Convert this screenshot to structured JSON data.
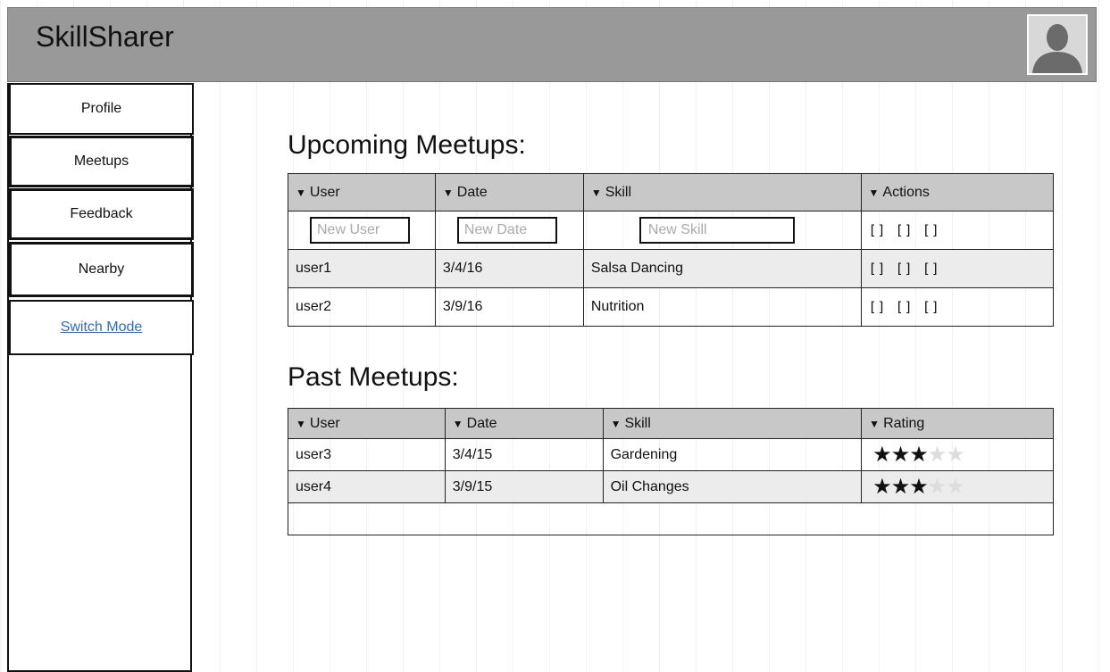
{
  "app": {
    "title": "SkillSharer"
  },
  "sidebar": {
    "items": [
      {
        "label": "Profile"
      },
      {
        "label": "Meetups"
      },
      {
        "label": "Feedback"
      },
      {
        "label": "Nearby"
      },
      {
        "label": "Switch Mode"
      }
    ]
  },
  "upcoming": {
    "title": "Upcoming Meetups:",
    "columns": [
      "User",
      "Date",
      "Skill",
      "Actions"
    ],
    "new_row": {
      "user_placeholder": "New User",
      "date_placeholder": "New Date",
      "skill_placeholder": "New Skill",
      "actions": "[] [] []"
    },
    "rows": [
      {
        "user": "user1",
        "date": "3/4/16",
        "skill": "Salsa Dancing",
        "actions": "[] [] []"
      },
      {
        "user": "user2",
        "date": "3/9/16",
        "skill": "Nutrition",
        "actions": "[] [] []"
      }
    ]
  },
  "past": {
    "title": "Past Meetups:",
    "columns": [
      "User",
      "Date",
      "Skill",
      "Rating"
    ],
    "rows": [
      {
        "user": "user3",
        "date": "3/4/15",
        "skill": "Gardening",
        "rating": 3,
        "max_rating": 5
      },
      {
        "user": "user4",
        "date": "3/9/15",
        "skill": "Oil Changes",
        "rating": 3,
        "max_rating": 5
      }
    ]
  },
  "icons": {
    "avatar": "user-silhouette-icon",
    "sort": "caret-down-icon",
    "star": "star-icon"
  }
}
